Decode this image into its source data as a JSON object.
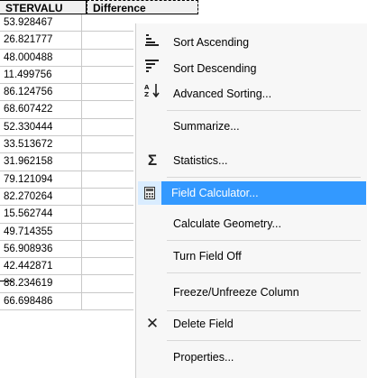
{
  "table": {
    "col1_header": "STERVALU",
    "col2_header": "Difference",
    "values": [
      "53.928467",
      "26.821777",
      "48.000488",
      "11.499756",
      "86.124756",
      "68.607422",
      "52.330444",
      "33.513672",
      "31.962158",
      "79.121094",
      "82.270264",
      "15.562744",
      "49.714355",
      "56.908936",
      "42.442871",
      "88.234619",
      "66.698486"
    ]
  },
  "menu": {
    "items": [
      {
        "label": "Sort Ascending",
        "icon": "sort-ascending-icon",
        "glyph": "≡"
      },
      {
        "label": "Sort Descending",
        "icon": "sort-descending-icon",
        "glyph": "≡"
      },
      {
        "label": "Advanced Sorting...",
        "icon": "advanced-sorting-icon",
        "glyph": "⇅"
      },
      {
        "label": "Summarize...",
        "icon": "",
        "glyph": ""
      },
      {
        "label": "Statistics...",
        "icon": "sigma-icon",
        "glyph": "Σ"
      },
      {
        "label": "Field Calculator...",
        "icon": "calculator-icon",
        "glyph": "▦"
      },
      {
        "label": "Calculate Geometry...",
        "icon": "",
        "glyph": ""
      },
      {
        "label": "Turn Field Off",
        "icon": "",
        "glyph": ""
      },
      {
        "label": "Freeze/Unfreeze Column",
        "icon": "",
        "glyph": ""
      },
      {
        "label": "Delete Field",
        "icon": "delete-x-icon",
        "glyph": "✕"
      },
      {
        "label": "Properties...",
        "icon": "",
        "glyph": ""
      }
    ],
    "highlighted_item": "Field Calculator...",
    "highlight_color": "#3399ff"
  }
}
